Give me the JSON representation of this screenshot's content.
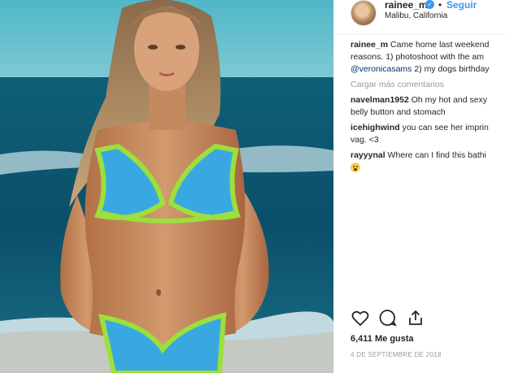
{
  "post": {
    "username": "rainee_m",
    "verified_icon": "verified-badge-icon",
    "separator": "•",
    "follow_label": "Seguir",
    "location": "Malibu, California"
  },
  "caption": {
    "user": "rainee_m",
    "line1": "Came home last weekend",
    "line2": "reasons. 1) photoshoot with the am",
    "mention": "@veronicasams",
    "line3_rest": "2) my dogs birthday"
  },
  "load_more_label": "Cargar más comentarios",
  "comments": [
    {
      "user": "navelman1952",
      "text_line1": "Oh my hot and sexy",
      "text_line2": "belly button and stomach"
    },
    {
      "user": "icehighwind",
      "text_line1": "you can see her imprin",
      "text_line2": "vag. <3"
    },
    {
      "user": "rayyynal",
      "text_line1": "Where can I find this bathi",
      "emoji": "fearful-face-emoji"
    }
  ],
  "likes_label": "6,411 Me gusta",
  "date_label": "4 DE SEPTIEMBRE DE 2018",
  "icons": [
    "heart-icon",
    "comment-icon",
    "share-icon"
  ]
}
